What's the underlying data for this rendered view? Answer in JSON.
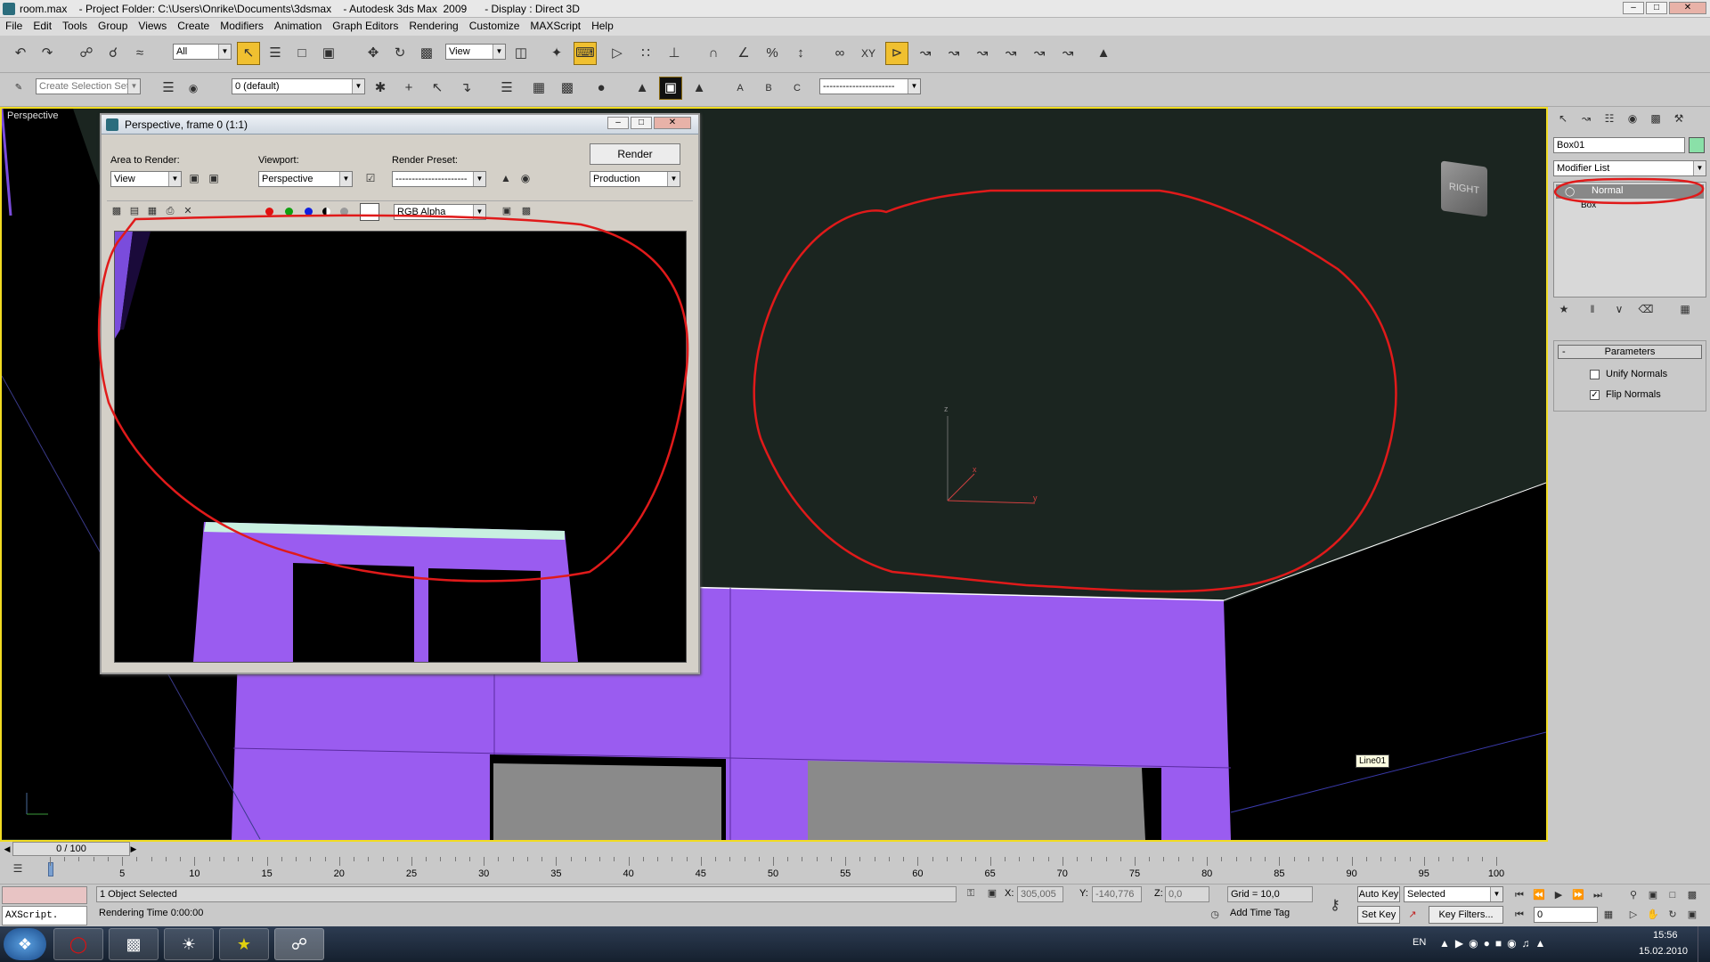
{
  "window": {
    "title": "room.max    - Project Folder: C:\\Users\\Onrike\\Documents\\3dsmax    - Autodesk 3ds Max  2009      - Display : Direct 3D"
  },
  "menu": [
    "File",
    "Edit",
    "Tools",
    "Group",
    "Views",
    "Create",
    "Modifiers",
    "Animation",
    "Graph Editors",
    "Rendering",
    "Customize",
    "MAXScript",
    "Help"
  ],
  "toolbar": {
    "selection_filter": "All",
    "ref_coord": "View",
    "named_selection_placeholder": "Create Selection Set",
    "layer": "0 (default)",
    "render_preset_dropdown": "----------------------"
  },
  "viewport": {
    "label": "Perspective",
    "viewcube_label": "RIGHT",
    "object_tooltip": "Line01",
    "axis_x": "x",
    "axis_y": "y",
    "axis_z": "z"
  },
  "render_window": {
    "title": "Perspective, frame 0 (1:1)",
    "area_label": "Area to Render:",
    "area_value": "View",
    "viewport_label": "Viewport:",
    "viewport_value": "Perspective",
    "preset_label": "Render Preset:",
    "preset_value": "----------------------",
    "render_button": "Render",
    "production_value": "Production",
    "channel_value": "RGB Alpha"
  },
  "command_panel": {
    "object_name": "Box01",
    "modifier_list": "Modifier List",
    "stack_items": [
      "Normal",
      "Box"
    ],
    "rollout_title": "Parameters",
    "rollout_collapse": "-",
    "unify_normals_label": "Unify Normals",
    "unify_normals_checked": false,
    "flip_normals_label": "Flip Normals",
    "flip_normals_checked": true
  },
  "timeline": {
    "frame_indicator": "0 / 100",
    "ticks": [
      "5",
      "10",
      "15",
      "20",
      "25",
      "30",
      "35",
      "40",
      "45",
      "50",
      "55",
      "60",
      "65",
      "70",
      "75",
      "80",
      "85",
      "90",
      "95",
      "100"
    ]
  },
  "status": {
    "maxscript": "AXScript.",
    "selection_status": "1 Object Selected",
    "prompt": "Rendering Time  0:00:00",
    "x_label": "X:",
    "x_value": "305,005",
    "y_label": "Y:",
    "y_value": "-140,776",
    "z_label": "Z:",
    "z_value": "0,0",
    "grid": "Grid = 10,0",
    "add_time_tag": "Add Time Tag",
    "auto_key": "Auto Key",
    "auto_key_mode": "Selected",
    "set_key": "Set Key",
    "key_filters": "Key Filters...",
    "current_frame": "0"
  },
  "taskbar": {
    "language": "EN",
    "time": "15:56",
    "date": "15.02.2010"
  },
  "colors": {
    "viewport_border": "#f1dc22",
    "annotation_red": "#e01a1a",
    "object_purple": "#9a5cf0",
    "viewport_bg": "#1b2520"
  }
}
